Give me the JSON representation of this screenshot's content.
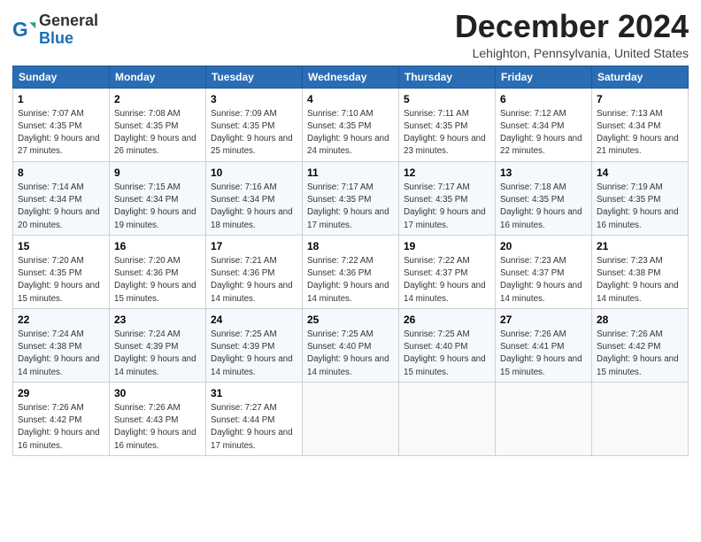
{
  "header": {
    "logo_line1": "General",
    "logo_line2": "Blue",
    "month_title": "December 2024",
    "location": "Lehighton, Pennsylvania, United States"
  },
  "days_of_week": [
    "Sunday",
    "Monday",
    "Tuesday",
    "Wednesday",
    "Thursday",
    "Friday",
    "Saturday"
  ],
  "weeks": [
    [
      {
        "num": "1",
        "sunrise": "7:07 AM",
        "sunset": "4:35 PM",
        "daylight": "9 hours and 27 minutes."
      },
      {
        "num": "2",
        "sunrise": "7:08 AM",
        "sunset": "4:35 PM",
        "daylight": "9 hours and 26 minutes."
      },
      {
        "num": "3",
        "sunrise": "7:09 AM",
        "sunset": "4:35 PM",
        "daylight": "9 hours and 25 minutes."
      },
      {
        "num": "4",
        "sunrise": "7:10 AM",
        "sunset": "4:35 PM",
        "daylight": "9 hours and 24 minutes."
      },
      {
        "num": "5",
        "sunrise": "7:11 AM",
        "sunset": "4:35 PM",
        "daylight": "9 hours and 23 minutes."
      },
      {
        "num": "6",
        "sunrise": "7:12 AM",
        "sunset": "4:34 PM",
        "daylight": "9 hours and 22 minutes."
      },
      {
        "num": "7",
        "sunrise": "7:13 AM",
        "sunset": "4:34 PM",
        "daylight": "9 hours and 21 minutes."
      }
    ],
    [
      {
        "num": "8",
        "sunrise": "7:14 AM",
        "sunset": "4:34 PM",
        "daylight": "9 hours and 20 minutes."
      },
      {
        "num": "9",
        "sunrise": "7:15 AM",
        "sunset": "4:34 PM",
        "daylight": "9 hours and 19 minutes."
      },
      {
        "num": "10",
        "sunrise": "7:16 AM",
        "sunset": "4:34 PM",
        "daylight": "9 hours and 18 minutes."
      },
      {
        "num": "11",
        "sunrise": "7:17 AM",
        "sunset": "4:35 PM",
        "daylight": "9 hours and 17 minutes."
      },
      {
        "num": "12",
        "sunrise": "7:17 AM",
        "sunset": "4:35 PM",
        "daylight": "9 hours and 17 minutes."
      },
      {
        "num": "13",
        "sunrise": "7:18 AM",
        "sunset": "4:35 PM",
        "daylight": "9 hours and 16 minutes."
      },
      {
        "num": "14",
        "sunrise": "7:19 AM",
        "sunset": "4:35 PM",
        "daylight": "9 hours and 16 minutes."
      }
    ],
    [
      {
        "num": "15",
        "sunrise": "7:20 AM",
        "sunset": "4:35 PM",
        "daylight": "9 hours and 15 minutes."
      },
      {
        "num": "16",
        "sunrise": "7:20 AM",
        "sunset": "4:36 PM",
        "daylight": "9 hours and 15 minutes."
      },
      {
        "num": "17",
        "sunrise": "7:21 AM",
        "sunset": "4:36 PM",
        "daylight": "9 hours and 14 minutes."
      },
      {
        "num": "18",
        "sunrise": "7:22 AM",
        "sunset": "4:36 PM",
        "daylight": "9 hours and 14 minutes."
      },
      {
        "num": "19",
        "sunrise": "7:22 AM",
        "sunset": "4:37 PM",
        "daylight": "9 hours and 14 minutes."
      },
      {
        "num": "20",
        "sunrise": "7:23 AM",
        "sunset": "4:37 PM",
        "daylight": "9 hours and 14 minutes."
      },
      {
        "num": "21",
        "sunrise": "7:23 AM",
        "sunset": "4:38 PM",
        "daylight": "9 hours and 14 minutes."
      }
    ],
    [
      {
        "num": "22",
        "sunrise": "7:24 AM",
        "sunset": "4:38 PM",
        "daylight": "9 hours and 14 minutes."
      },
      {
        "num": "23",
        "sunrise": "7:24 AM",
        "sunset": "4:39 PM",
        "daylight": "9 hours and 14 minutes."
      },
      {
        "num": "24",
        "sunrise": "7:25 AM",
        "sunset": "4:39 PM",
        "daylight": "9 hours and 14 minutes."
      },
      {
        "num": "25",
        "sunrise": "7:25 AM",
        "sunset": "4:40 PM",
        "daylight": "9 hours and 14 minutes."
      },
      {
        "num": "26",
        "sunrise": "7:25 AM",
        "sunset": "4:40 PM",
        "daylight": "9 hours and 15 minutes."
      },
      {
        "num": "27",
        "sunrise": "7:26 AM",
        "sunset": "4:41 PM",
        "daylight": "9 hours and 15 minutes."
      },
      {
        "num": "28",
        "sunrise": "7:26 AM",
        "sunset": "4:42 PM",
        "daylight": "9 hours and 15 minutes."
      }
    ],
    [
      {
        "num": "29",
        "sunrise": "7:26 AM",
        "sunset": "4:42 PM",
        "daylight": "9 hours and 16 minutes."
      },
      {
        "num": "30",
        "sunrise": "7:26 AM",
        "sunset": "4:43 PM",
        "daylight": "9 hours and 16 minutes."
      },
      {
        "num": "31",
        "sunrise": "7:27 AM",
        "sunset": "4:44 PM",
        "daylight": "9 hours and 17 minutes."
      },
      null,
      null,
      null,
      null
    ]
  ]
}
